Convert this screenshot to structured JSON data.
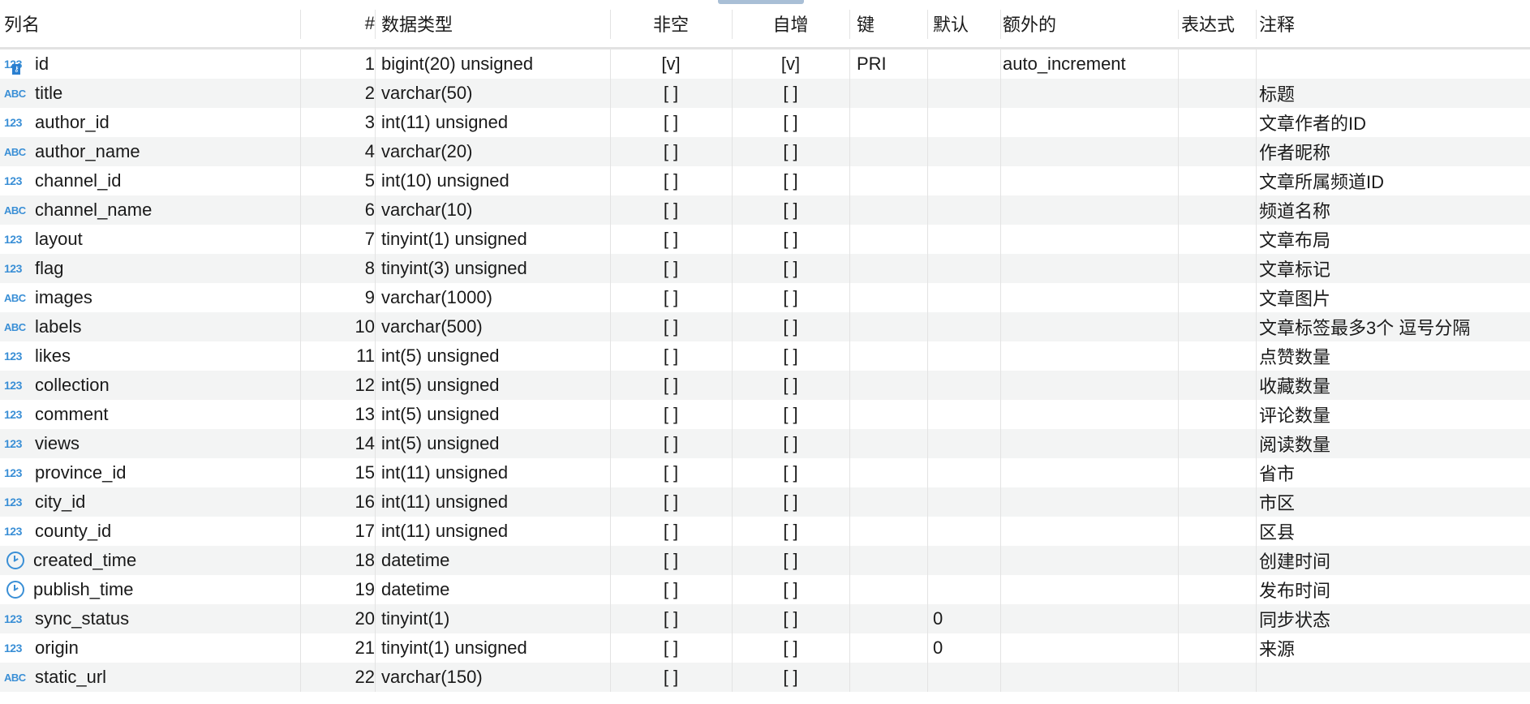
{
  "header": {
    "name": "列名",
    "num": "#",
    "type": "数据类型",
    "notnull": "非空",
    "autoinc": "自增",
    "key": "键",
    "default": "默认",
    "extra": "额外的",
    "expr": "表达式",
    "comment": "注释"
  },
  "colors": {
    "icon": "#3a8fd6",
    "alt_row": "#f3f4f4"
  },
  "rows": [
    {
      "icon": "123",
      "key_icon": true,
      "name": "id",
      "num": "1",
      "type": "bigint(20) unsigned",
      "notnull": "[v]",
      "autoinc": "[v]",
      "key": "PRI",
      "default": "",
      "extra": "auto_increment",
      "expr": "",
      "comment": ""
    },
    {
      "icon": "ABC",
      "name": "title",
      "num": "2",
      "type": "varchar(50)",
      "notnull": "[ ]",
      "autoinc": "[ ]",
      "key": "",
      "default": "",
      "extra": "",
      "expr": "",
      "comment": "标题"
    },
    {
      "icon": "123",
      "name": "author_id",
      "num": "3",
      "type": "int(11) unsigned",
      "notnull": "[ ]",
      "autoinc": "[ ]",
      "key": "",
      "default": "",
      "extra": "",
      "expr": "",
      "comment": "文章作者的ID"
    },
    {
      "icon": "ABC",
      "name": "author_name",
      "num": "4",
      "type": "varchar(20)",
      "notnull": "[ ]",
      "autoinc": "[ ]",
      "key": "",
      "default": "",
      "extra": "",
      "expr": "",
      "comment": "作者昵称"
    },
    {
      "icon": "123",
      "name": "channel_id",
      "num": "5",
      "type": "int(10) unsigned",
      "notnull": "[ ]",
      "autoinc": "[ ]",
      "key": "",
      "default": "",
      "extra": "",
      "expr": "",
      "comment": "文章所属频道ID"
    },
    {
      "icon": "ABC",
      "name": "channel_name",
      "num": "6",
      "type": "varchar(10)",
      "notnull": "[ ]",
      "autoinc": "[ ]",
      "key": "",
      "default": "",
      "extra": "",
      "expr": "",
      "comment": "频道名称"
    },
    {
      "icon": "123",
      "name": "layout",
      "num": "7",
      "type": "tinyint(1) unsigned",
      "notnull": "[ ]",
      "autoinc": "[ ]",
      "key": "",
      "default": "",
      "extra": "",
      "expr": "",
      "comment": "文章布局"
    },
    {
      "icon": "123",
      "name": "flag",
      "num": "8",
      "type": "tinyint(3) unsigned",
      "notnull": "[ ]",
      "autoinc": "[ ]",
      "key": "",
      "default": "",
      "extra": "",
      "expr": "",
      "comment": "文章标记"
    },
    {
      "icon": "ABC",
      "name": "images",
      "num": "9",
      "type": "varchar(1000)",
      "notnull": "[ ]",
      "autoinc": "[ ]",
      "key": "",
      "default": "",
      "extra": "",
      "expr": "",
      "comment": "文章图片"
    },
    {
      "icon": "ABC",
      "name": "labels",
      "num": "10",
      "type": "varchar(500)",
      "notnull": "[ ]",
      "autoinc": "[ ]",
      "key": "",
      "default": "",
      "extra": "",
      "expr": "",
      "comment": "文章标签最多3个 逗号分隔"
    },
    {
      "icon": "123",
      "name": "likes",
      "num": "11",
      "type": "int(5) unsigned",
      "notnull": "[ ]",
      "autoinc": "[ ]",
      "key": "",
      "default": "",
      "extra": "",
      "expr": "",
      "comment": "点赞数量"
    },
    {
      "icon": "123",
      "name": "collection",
      "num": "12",
      "type": "int(5) unsigned",
      "notnull": "[ ]",
      "autoinc": "[ ]",
      "key": "",
      "default": "",
      "extra": "",
      "expr": "",
      "comment": "收藏数量"
    },
    {
      "icon": "123",
      "name": "comment",
      "num": "13",
      "type": "int(5) unsigned",
      "notnull": "[ ]",
      "autoinc": "[ ]",
      "key": "",
      "default": "",
      "extra": "",
      "expr": "",
      "comment": "评论数量"
    },
    {
      "icon": "123",
      "name": "views",
      "num": "14",
      "type": "int(5) unsigned",
      "notnull": "[ ]",
      "autoinc": "[ ]",
      "key": "",
      "default": "",
      "extra": "",
      "expr": "",
      "comment": "阅读数量"
    },
    {
      "icon": "123",
      "name": "province_id",
      "num": "15",
      "type": "int(11) unsigned",
      "notnull": "[ ]",
      "autoinc": "[ ]",
      "key": "",
      "default": "",
      "extra": "",
      "expr": "",
      "comment": "省市"
    },
    {
      "icon": "123",
      "name": "city_id",
      "num": "16",
      "type": "int(11) unsigned",
      "notnull": "[ ]",
      "autoinc": "[ ]",
      "key": "",
      "default": "",
      "extra": "",
      "expr": "",
      "comment": "市区"
    },
    {
      "icon": "123",
      "name": "county_id",
      "num": "17",
      "type": "int(11) unsigned",
      "notnull": "[ ]",
      "autoinc": "[ ]",
      "key": "",
      "default": "",
      "extra": "",
      "expr": "",
      "comment": "区县"
    },
    {
      "icon": "clock",
      "name": "created_time",
      "num": "18",
      "type": "datetime",
      "notnull": "[ ]",
      "autoinc": "[ ]",
      "key": "",
      "default": "",
      "extra": "",
      "expr": "",
      "comment": "创建时间"
    },
    {
      "icon": "clock",
      "name": "publish_time",
      "num": "19",
      "type": "datetime",
      "notnull": "[ ]",
      "autoinc": "[ ]",
      "key": "",
      "default": "",
      "extra": "",
      "expr": "",
      "comment": "发布时间"
    },
    {
      "icon": "123",
      "name": "sync_status",
      "num": "20",
      "type": "tinyint(1)",
      "notnull": "[ ]",
      "autoinc": "[ ]",
      "key": "",
      "default": "0",
      "extra": "",
      "expr": "",
      "comment": "同步状态"
    },
    {
      "icon": "123",
      "name": "origin",
      "num": "21",
      "type": "tinyint(1) unsigned",
      "notnull": "[ ]",
      "autoinc": "[ ]",
      "key": "",
      "default": "0",
      "extra": "",
      "expr": "",
      "comment": "来源"
    },
    {
      "icon": "ABC",
      "name": "static_url",
      "num": "22",
      "type": "varchar(150)",
      "notnull": "[ ]",
      "autoinc": "[ ]",
      "key": "",
      "default": "",
      "extra": "",
      "expr": "",
      "comment": ""
    }
  ]
}
